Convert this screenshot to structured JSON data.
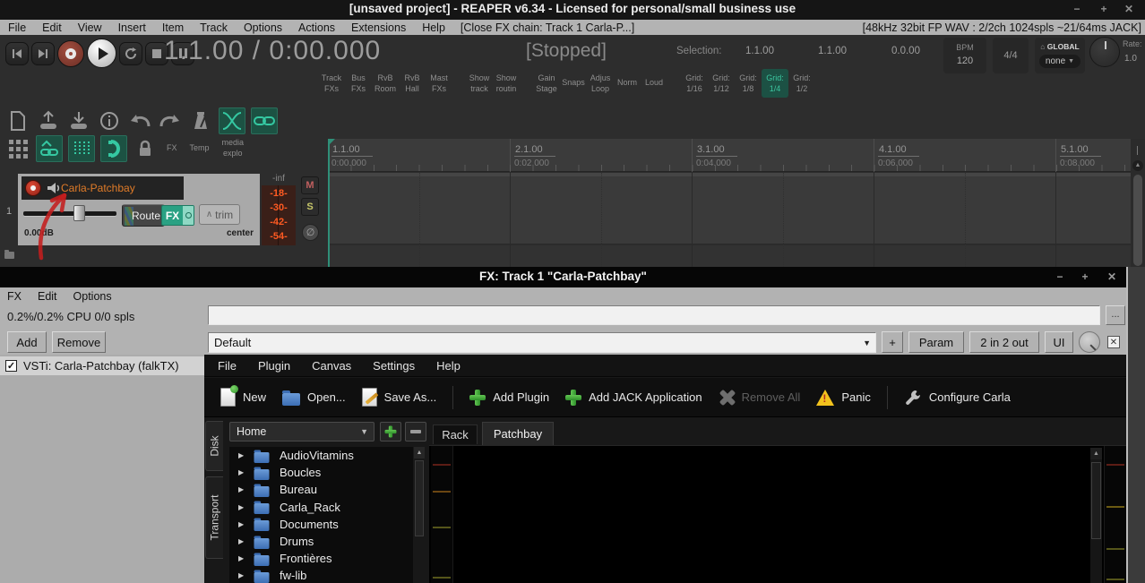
{
  "window": {
    "title": "[unsaved project] - REAPER v6.34 - Licensed for personal/small business use",
    "minimize": "−",
    "maximize": "+",
    "close": "✕"
  },
  "menubar": {
    "items": [
      "File",
      "Edit",
      "View",
      "Insert",
      "Item",
      "Track",
      "Options",
      "Actions",
      "Extensions",
      "Help"
    ],
    "fx_hint": "[Close FX chain: Track 1 Carla-P...]",
    "audio_status": "[48kHz 32bit FP WAV : 2/2ch 1024spls ~21/64ms JACK]"
  },
  "transport": {
    "time": "1.1.00 / 0:00.000",
    "status": "[Stopped]",
    "selection_label": "Selection:",
    "selection_start": "1.1.00",
    "selection_end": "1.1.00",
    "selection_length": "0.0.00",
    "bpm_label": "BPM",
    "bpm_value": "120",
    "time_signature": "4/4",
    "global_label": "GLOBAL",
    "global_value": "none",
    "rate_label": "Rate:",
    "rate_value": "1.0"
  },
  "quick_buttons": [
    {
      "l1": "Track",
      "l2": "FXs"
    },
    {
      "l1": "Bus",
      "l2": "FXs"
    },
    {
      "l1": "RvB",
      "l2": "Room"
    },
    {
      "l1": "RvB",
      "l2": "Hall"
    },
    {
      "l1": "Mast",
      "l2": "FXs"
    },
    {
      "l1": "Show",
      "l2": "track"
    },
    {
      "l1": "Show",
      "l2": "routin"
    },
    {
      "l1": "Gain",
      "l2": "Stage"
    },
    {
      "l1": "Snaps",
      "l2": ""
    },
    {
      "l1": "Adjus",
      "l2": "Loop"
    },
    {
      "l1": "Norm",
      "l2": ""
    },
    {
      "l1": "Loud",
      "l2": ""
    },
    {
      "l1": "Grid:",
      "l2": "1/16"
    },
    {
      "l1": "Grid:",
      "l2": "1/12"
    },
    {
      "l1": "Grid:",
      "l2": "1/8"
    },
    {
      "l1": "Grid:",
      "l2": "1/4"
    },
    {
      "l1": "Grid:",
      "l2": "1/2"
    }
  ],
  "icon_labels": {
    "fx": "FX",
    "temp": "Temp",
    "media_line1": "media",
    "media_line2": "explo"
  },
  "track": {
    "number": "1",
    "name": "Carla-Patchbay",
    "volume": "0.00dB",
    "pan": "center",
    "route_label": "Route",
    "fx_label": "FX",
    "trim_label": "trim",
    "trim_node": "∧",
    "mute": "M",
    "solo": "S",
    "phase": "∅",
    "meter_top": "-inf",
    "meter_marks": [
      "-18-",
      "-30-",
      "-42-",
      "-54-"
    ]
  },
  "ruler": [
    {
      "beat": "1.1.00",
      "time": "0:00.000"
    },
    {
      "beat": "2.1.00",
      "time": "0:02.000"
    },
    {
      "beat": "3.1.00",
      "time": "0:04.000"
    },
    {
      "beat": "4.1.00",
      "time": "0:06.000"
    },
    {
      "beat": "5.1.00",
      "time": "0:08.000"
    }
  ],
  "fx_window": {
    "title": "FX: Track 1 \"Carla-Patchbay\"",
    "minimize": "−",
    "maximize": "+",
    "close": "✕",
    "menus": [
      "FX",
      "Edit",
      "Options"
    ],
    "cpu_status": "0.2%/0.2% CPU 0/0 spls",
    "add_label": "Add",
    "remove_label": "Remove",
    "preset_value": "Default",
    "more_label": "...",
    "add_slot_label": "+",
    "param_label": "Param",
    "io_label": "2 in 2 out",
    "ui_label": "UI",
    "bypass_mark": "✕",
    "chain": [
      {
        "checked": "✓",
        "label": "VSTi: Carla-Patchbay (falkTX)"
      }
    ]
  },
  "carla": {
    "menus": [
      "File",
      "Plugin",
      "Canvas",
      "Settings",
      "Help"
    ],
    "toolbar": {
      "new": "New",
      "open": "Open...",
      "save_as": "Save As...",
      "add_plugin": "Add Plugin",
      "add_jack": "Add JACK Application",
      "remove_all": "Remove All",
      "panic": "Panic",
      "configure": "Configure Carla"
    },
    "side_tabs": [
      "Disk",
      "Transport"
    ],
    "location_value": "Home",
    "tabs": [
      "Rack",
      "Patchbay"
    ],
    "folders": [
      "AudioVitamins",
      "Boucles",
      "Bureau",
      "Carla_Rack",
      "Documents",
      "Drums",
      "Frontières",
      "fw-lib"
    ]
  },
  "colors": {
    "accent_teal": "#2fae92",
    "record_red": "#c0392b",
    "track_name_orange": "#e07b28",
    "meter_orange": "#ff5a22",
    "annotation_red": "#c41e1e",
    "carla_green": "#3db33d",
    "panic_yellow": "#f2c21d"
  }
}
